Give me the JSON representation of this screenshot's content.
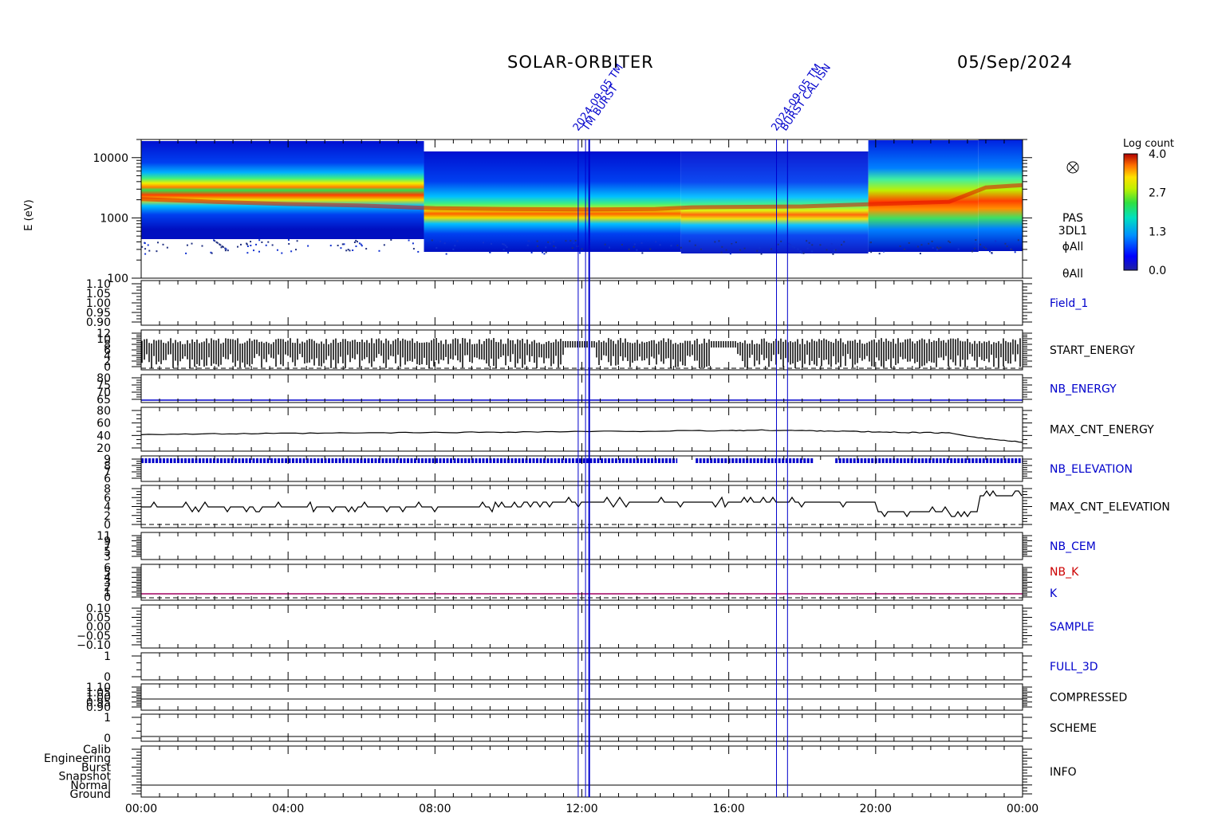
{
  "header": {
    "title": "SOLAR-ORBITER",
    "date": "05/Sep/2024"
  },
  "chart_data": {
    "type": "line",
    "time_range": [
      "00:00",
      "24:00"
    ],
    "x_tick_labels": [
      "00:00",
      "04:00",
      "08:00",
      "12:00",
      "16:00",
      "20:00",
      "00:00"
    ],
    "spectrogram": {
      "ylabel": "E (eV)",
      "y_scale": "log",
      "y_tick_labels": [
        "10000",
        "1000",
        "100"
      ],
      "ylim": [
        100,
        20000
      ],
      "right_labels": [
        "PAS",
        "3DL1",
        "ϕAll",
        "θAll"
      ],
      "colorbar": {
        "title": "Log count",
        "ticks": [
          "4.0",
          "2.7",
          "1.3",
          "0.0"
        ],
        "range": [
          0.0,
          4.0
        ]
      },
      "peak_energy_track_ev": [
        [
          0,
          2050
        ],
        [
          2,
          1850
        ],
        [
          4,
          1700
        ],
        [
          6,
          1600
        ],
        [
          8,
          1450
        ],
        [
          10,
          1400
        ],
        [
          12,
          1380
        ],
        [
          14,
          1400
        ],
        [
          15,
          1500
        ],
        [
          18,
          1550
        ],
        [
          20,
          1700
        ],
        [
          22,
          1850
        ],
        [
          23,
          3200
        ],
        [
          24,
          3500
        ]
      ]
    },
    "events": {
      "times_h": [
        11.9,
        12.1,
        12.2,
        17.3,
        17.6
      ],
      "labels": [
        "2024-09-05",
        "TM",
        "BURST",
        "2024-09-05",
        "TM",
        "BURST",
        "CAL",
        "ISN"
      ]
    },
    "panels": [
      {
        "name": "Field_1",
        "color": "#0000cc",
        "ticks": [
          "1.10",
          "1.05",
          "1.00",
          "0.95",
          "0.90"
        ],
        "ylim": [
          0.9,
          1.1
        ]
      },
      {
        "name": "START_ENERGY",
        "color": "#000000",
        "ticks": [
          "12",
          "10",
          "8",
          "6",
          "4",
          "2",
          "0"
        ],
        "ylim": [
          0,
          12
        ]
      },
      {
        "name": "NB_ENERGY",
        "color": "#0000cc",
        "ticks": [
          "80",
          "75",
          "70",
          "65"
        ],
        "ylim": [
          64,
          80
        ],
        "value": 64
      },
      {
        "name": "MAX_CNT_ENERGY",
        "color": "#000000",
        "ticks": [
          "80",
          "60",
          "40",
          "20"
        ],
        "ylim": [
          10,
          90
        ],
        "series_x": [
          0,
          2,
          4,
          6,
          8,
          10,
          12,
          14,
          16,
          17,
          18,
          19,
          20,
          21,
          22,
          23,
          24
        ],
        "series_y": [
          39,
          40,
          41,
          42,
          43,
          44,
          45,
          46,
          47,
          48,
          47,
          46,
          44,
          43,
          42,
          30,
          22
        ]
      },
      {
        "name": "NB_ELEVATION",
        "color": "#0000cc",
        "ticks": [
          "9",
          "8",
          "7",
          "6"
        ],
        "ylim": [
          6,
          9
        ],
        "value": 9
      },
      {
        "name": "MAX_CNT_ELEVATION",
        "color": "#000000",
        "ticks": [
          "8",
          "6",
          "4",
          "2",
          "0"
        ],
        "ylim": [
          0,
          8
        ]
      },
      {
        "name": "NB_CEM",
        "color": "#0000cc",
        "ticks": [
          "11",
          "9",
          "7",
          "5",
          "3"
        ],
        "ylim": [
          0,
          12
        ]
      },
      {
        "name": "NB_K",
        "color": "#cc0000",
        "ticks": [
          "6",
          "5",
          "4",
          "3",
          "2",
          "1",
          "0"
        ],
        "ylim": [
          0,
          6
        ],
        "second": {
          "name": "K",
          "color": "#0000cc"
        }
      },
      {
        "name": "SAMPLE",
        "color": "#0000cc",
        "ticks": [
          "0.10",
          "0.05",
          "0.00",
          "−0.05",
          "−0.10"
        ],
        "ylim": [
          -0.1,
          0.1
        ]
      },
      {
        "name": "FULL_3D",
        "color": "#0000cc",
        "ticks": [
          "1",
          "0"
        ],
        "ylim": [
          0,
          1
        ]
      },
      {
        "name": "COMPRESSED",
        "color": "#000000",
        "ticks": [
          "1.10",
          "1.05",
          "1.00",
          "0.95",
          "0.90"
        ],
        "ylim": [
          0.9,
          1.1
        ]
      },
      {
        "name": "SCHEME",
        "color": "#000000",
        "ticks": [
          "1",
          "0"
        ],
        "ylim": [
          0,
          1
        ]
      },
      {
        "name": "INFO",
        "color": "#000000",
        "ticks": [
          "Calib",
          "Engineering",
          "Burst",
          "Snapshot",
          "Normal",
          "Ground"
        ]
      }
    ]
  }
}
